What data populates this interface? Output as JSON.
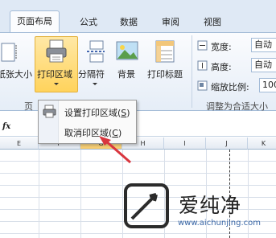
{
  "tabs": [
    {
      "label": "页面布局",
      "active": true
    },
    {
      "label": "公式"
    },
    {
      "label": "数据"
    },
    {
      "label": "审阅"
    },
    {
      "label": "视图"
    }
  ],
  "ribbon": {
    "scale_to_size_partial": "纸张大小",
    "print_area": "打印区域",
    "breaks": "分隔符",
    "background": "背景",
    "print_titles": "打印标题",
    "width_label": "宽度:",
    "width_value": "自动",
    "height_label": "高度:",
    "height_value": "自动",
    "scale_label": "缩放比例:",
    "scale_value": "100",
    "group_page_setup_partial": "页",
    "group_scale_to_fit": "调整为合适大小"
  },
  "formula_bar": {
    "fx": "fx"
  },
  "columns": [
    "E",
    "F",
    "G",
    "H",
    "I",
    "J",
    "K"
  ],
  "selected_column": "G",
  "menu": {
    "set_print_area": "设置打印区域",
    "set_print_area_key": "S",
    "clear_print_area": "取消印区域",
    "clear_print_area_key": "C"
  },
  "watermark": {
    "text": "爱纯净",
    "url": "www.aichunjing.com"
  },
  "colors": {
    "accent": "#ffd35c",
    "arrow": "#d9363e"
  }
}
